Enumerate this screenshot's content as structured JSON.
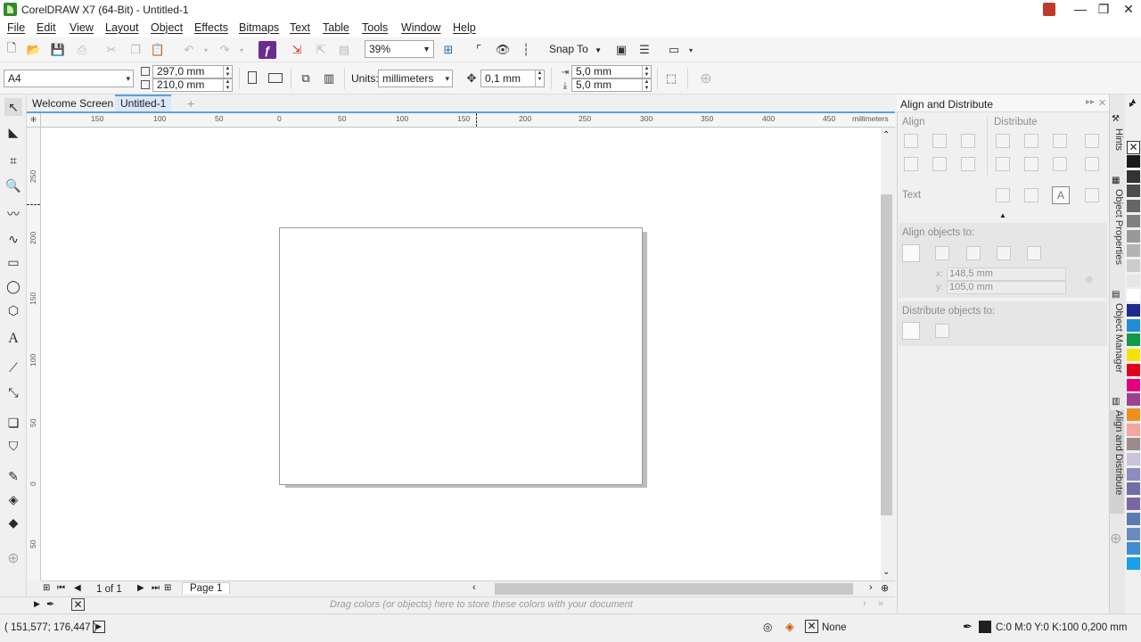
{
  "window": {
    "title": "CorelDRAW X7 (64-Bit) - Untitled-1"
  },
  "menu": [
    "File",
    "Edit",
    "View",
    "Layout",
    "Object",
    "Effects",
    "Bitmaps",
    "Text",
    "Table",
    "Tools",
    "Window",
    "Help"
  ],
  "toolbar": {
    "zoom": "39%",
    "snap_to": "Snap To"
  },
  "property_bar": {
    "page_size": "A4",
    "width": "297,0 mm",
    "height": "210,0 mm",
    "units_label": "Units:",
    "units": "millimeters",
    "nudge": "0,1 mm",
    "dup_x": "5,0 mm",
    "dup_y": "5,0 mm"
  },
  "tabs": [
    "Welcome Screen",
    "Untitled-1"
  ],
  "ruler": {
    "unit": "millimeters",
    "top": [
      "150",
      "100",
      "50",
      "0",
      "50",
      "100",
      "150",
      "200",
      "250",
      "300",
      "350",
      "400",
      "450"
    ],
    "left": [
      "250",
      "200",
      "150",
      "100",
      "50",
      "0",
      "50"
    ]
  },
  "page_nav": {
    "count": "1 of 1",
    "page_tab": "Page 1"
  },
  "drawer_hint": "Drag colors (or objects) here to store these colors with your document",
  "status": {
    "coords": "( 151,577; 176,447 )",
    "fill": "None",
    "outline": "C:0 M:0 Y:0 K:100  0,200 mm"
  },
  "docker": {
    "title": "Align and Distribute",
    "align_label": "Align",
    "distribute_label": "Distribute",
    "text_label": "Text",
    "align_objects_to": "Align objects to:",
    "x_label": "x:",
    "x_value": "148,5 mm",
    "y_label": "y:",
    "y_value": "105,0 mm",
    "distribute_objects_to": "Distribute objects to:"
  },
  "side_tabs": [
    "Hints",
    "Object Properties",
    "Object Manager",
    "Align and Distribute"
  ],
  "palette": [
    "#1a1a1a",
    "#333333",
    "#4d4d4d",
    "#666666",
    "#808080",
    "#999999",
    "#b3b3b3",
    "#cccccc",
    "#e6e6e6",
    "#ffffff",
    "#1f2a8c",
    "#1e8fd6",
    "#0f9a4a",
    "#f4e300",
    "#e3001b",
    "#e6007e",
    "#a0418d",
    "#f28e1c",
    "#f4a6a0",
    "#9e8a8a",
    "#c9c4d9",
    "#8c8cbf",
    "#6f6fa8",
    "#7c65a3",
    "#5a7cb0",
    "#6a8bbd",
    "#3e8fd1",
    "#1aa0e8"
  ]
}
